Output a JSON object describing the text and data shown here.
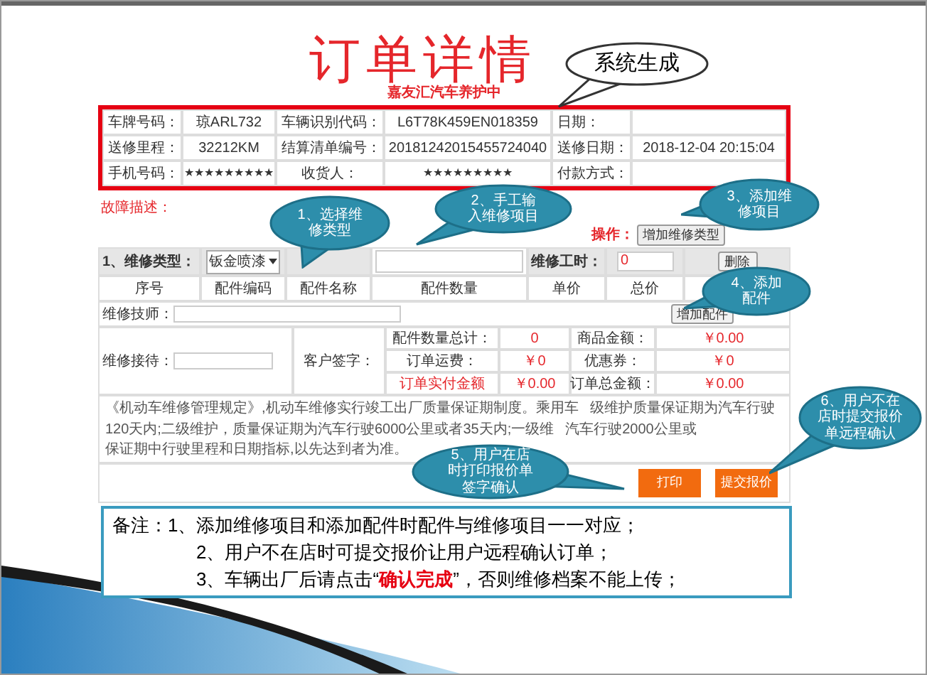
{
  "title": "订单详情",
  "subtitle": "嘉友汇汽车养护中",
  "info_table": {
    "rows": [
      [
        "车牌号码：",
        "琼ARL732",
        "车辆识别代码：",
        "L6T78K459EN018359",
        "日期："
      ],
      [
        "送修里程：",
        "32212KM",
        "结算清单编号：",
        "20181242015455724040",
        "送修日期：",
        "2018-12-04 20:15:04"
      ],
      [
        "手机号码：",
        "★★★★★★★★★",
        "收货人：",
        "★★★★★★★★★",
        "付款方式："
      ]
    ]
  },
  "fault": {
    "label": "故障描述：",
    "operation_label": "操作：",
    "add_type_button": "增加维修类型"
  },
  "repair_item": {
    "type_label": "1、维修类型：",
    "type_value": "钣金喷漆",
    "hours_label": "维修工时：",
    "hours_value": "0",
    "delete_button": "删除"
  },
  "parts_columns": [
    "序号",
    "配件编码",
    "配件名称",
    "配件数量",
    "单价",
    "总价"
  ],
  "technician": {
    "label": "维修技师：",
    "add_part_button": "增加配件"
  },
  "summary": {
    "reception_label": "维修接待：",
    "signature_label": "客户签字：",
    "rows": [
      {
        "label": "配件数量总计：",
        "value": "0",
        "label_2": "商品金额：",
        "value_2": "￥0.00",
        "emphasized": false
      },
      {
        "label": "订单运费：",
        "value": "￥0",
        "label_2": "优惠券：",
        "value_2": "￥0",
        "emphasized": false
      },
      {
        "label": "订单实付金额",
        "value": "￥0.00",
        "label_2": "订单总金额：",
        "value_2": "￥0.00",
        "emphasized": true
      }
    ]
  },
  "notice": {
    "fragments": [
      "《机动车维修管理规定》,机动车维修实行竣工出厂质量保证期制度。乘用车",
      "级维护质量保证期为汽车行驶",
      "120天内;二级维护，质量保证期为汽车行驶6000公里或者35天内;一级维",
      "汽车行驶2000公里或",
      "保证期中行驶里程和日期指标,以先达到者为准。"
    ]
  },
  "buttons": [
    {
      "label": "打印"
    },
    {
      "label": "提交报价"
    }
  ],
  "callouts": [
    {
      "kind": "system",
      "lines": [
        "系统生成"
      ]
    },
    {
      "kind": "step",
      "lines": [
        "1、选择维",
        "修类型"
      ]
    },
    {
      "kind": "step",
      "lines": [
        "2、手工输",
        "入维修项目"
      ]
    },
    {
      "kind": "step",
      "lines": [
        "3、添加维",
        "修项目"
      ]
    },
    {
      "kind": "step",
      "lines": [
        "4、添加",
        "配件"
      ]
    },
    {
      "kind": "step",
      "lines": [
        "5、用户在店",
        "时打印报价单",
        "签字确认"
      ]
    },
    {
      "kind": "step",
      "lines": [
        "6、用户不在",
        "店时提交报价",
        "单远程确认"
      ]
    }
  ],
  "note": {
    "label": "备注：",
    "lines": [
      "1、添加维修项目和添加配件时配件与维修项目一一对应；",
      "2、用户不在店时可提交报价让用户远程确认订单；",
      "3、车辆出厂后请点击“**确认完成**”，否则维修档案不能上传；"
    ]
  }
}
